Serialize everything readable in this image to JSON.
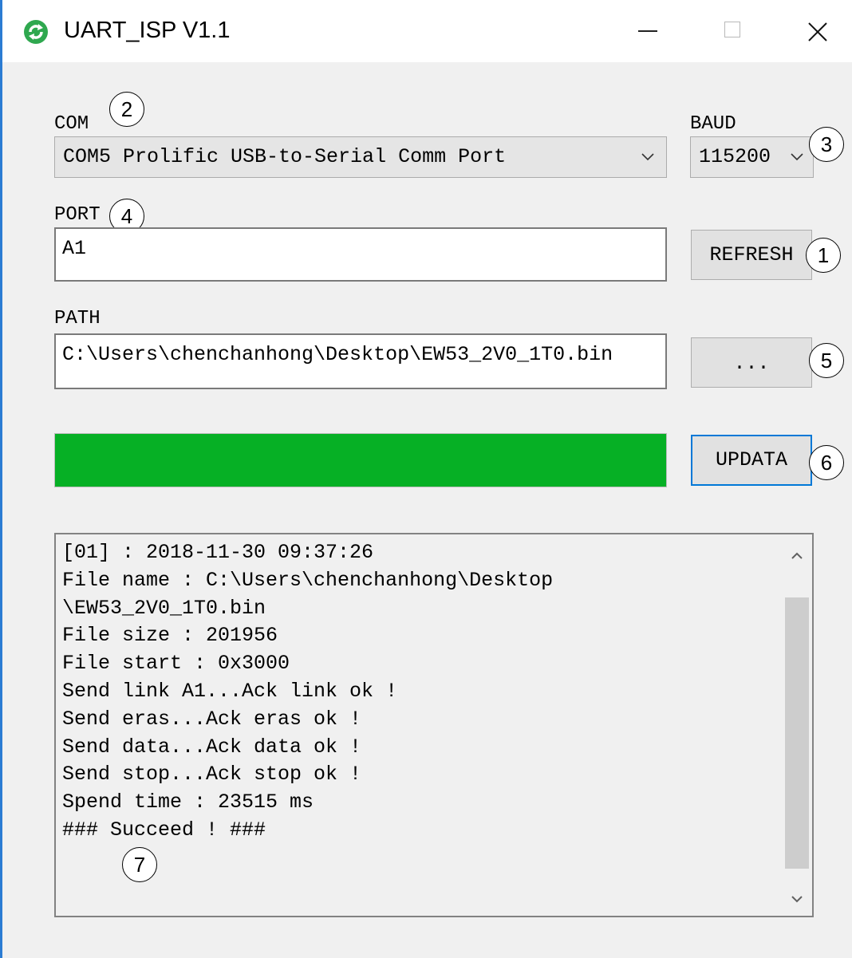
{
  "window": {
    "title": "UART_ISP V1.1",
    "icon": "green-refresh-arrows-icon",
    "controls": {
      "minimize": "minimize-icon",
      "maximize": "maximize-icon",
      "close": "close-icon"
    }
  },
  "com": {
    "label": "COM",
    "selected": "COM5 Prolific USB-to-Serial Comm Port",
    "callout": "2"
  },
  "baud": {
    "label": "BAUD",
    "selected": "115200",
    "callout": "3"
  },
  "port": {
    "label": "PORT",
    "value": "A1",
    "callout": "4"
  },
  "refresh": {
    "label": "REFRESH",
    "callout": "1"
  },
  "path": {
    "label": "PATH",
    "value": "C:\\Users\\chenchanhong\\Desktop\\EW53_2V0_1T0.bin"
  },
  "browse": {
    "label": "...",
    "callout": "5"
  },
  "progress": {
    "percent": 100,
    "color": "#06b025"
  },
  "update": {
    "label": "UPDATA",
    "callout": "6"
  },
  "log": {
    "lines": [
      "[01] : 2018-11-30 09:37:26",
      "File name : C:\\Users\\chenchanhong\\Desktop",
      "\\EW53_2V0_1T0.bin",
      "File size : 201956",
      "File start : 0x3000",
      "Send link A1...Ack link ok !",
      "Send eras...Ack eras ok !",
      "Send data...Ack data ok !",
      "Send stop...Ack stop ok !",
      "Spend time : 23515 ms",
      "### Succeed ! ###"
    ],
    "callout": "7",
    "scroll_position": 0.05,
    "scroll_visible_fraction": 0.9
  },
  "colors": {
    "accent": "#0078d7",
    "progress": "#06b025",
    "window_border": "#2b7cd3"
  }
}
